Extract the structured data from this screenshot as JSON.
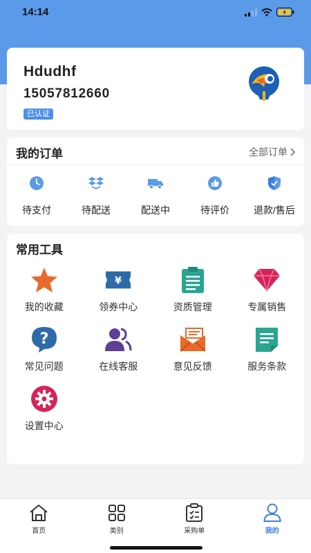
{
  "status": {
    "time": "14:14"
  },
  "profile": {
    "name": "Hdudhf",
    "phone": "15057812660",
    "badge": "已认证"
  },
  "orders": {
    "title": "我的订单",
    "view_all": "全部订单",
    "items": [
      {
        "label": "待支付",
        "icon": "clock-icon"
      },
      {
        "label": "待配送",
        "icon": "box-icon"
      },
      {
        "label": "配送中",
        "icon": "truck-icon"
      },
      {
        "label": "待评价",
        "icon": "thumbs-up-icon"
      },
      {
        "label": "退款/售后",
        "icon": "shield-icon"
      }
    ]
  },
  "tools": {
    "title": "常用工具",
    "items": [
      {
        "label": "我的收藏",
        "icon": "star-icon"
      },
      {
        "label": "领券中心",
        "icon": "coupon-icon"
      },
      {
        "label": "资质管理",
        "icon": "clipboard-icon"
      },
      {
        "label": "专属销售",
        "icon": "diamond-icon"
      },
      {
        "label": "常见问题",
        "icon": "question-icon"
      },
      {
        "label": "在线客服",
        "icon": "users-icon"
      },
      {
        "label": "意见反馈",
        "icon": "envelope-icon"
      },
      {
        "label": "服务条款",
        "icon": "document-icon"
      },
      {
        "label": "设置中心",
        "icon": "gear-icon"
      }
    ]
  },
  "tabbar": {
    "items": [
      {
        "label": "首页",
        "icon": "home-icon"
      },
      {
        "label": "类别",
        "icon": "grid-icon"
      },
      {
        "label": "采购单",
        "icon": "purchase-list-icon"
      },
      {
        "label": "我的",
        "icon": "person-icon",
        "active": true
      }
    ]
  },
  "colors": {
    "header": "#5b9ae9",
    "accent": "#3b7fe0",
    "star": "#e8692a",
    "coupon": "#2f6aa8",
    "clipboard": "#2aa58f",
    "diamond": "#d6245a",
    "question": "#2f6aa8",
    "users": "#5e3f97",
    "envelope": "#e8692a",
    "document": "#2aa58f",
    "gear": "#d6245a"
  }
}
